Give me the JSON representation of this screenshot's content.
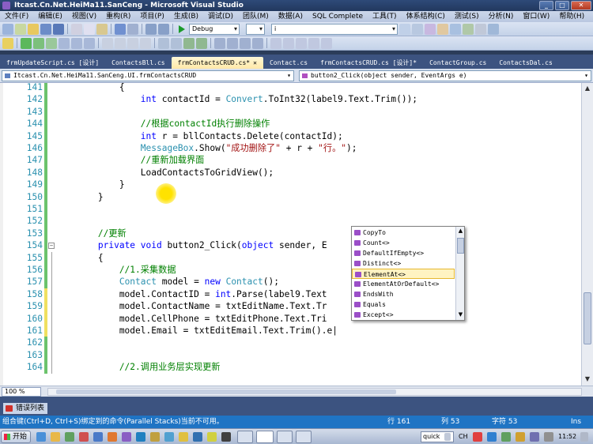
{
  "window": {
    "title": "Itcast.Cn.Net.HeiMa11.SanCeng - Microsoft Visual Studio",
    "controls": [
      "_",
      "□",
      "✕"
    ]
  },
  "menu": [
    "文件(F)",
    "编辑(E)",
    "视图(V)",
    "重构(R)",
    "项目(P)",
    "生成(B)",
    "调试(D)",
    "团队(M)",
    "数据(A)",
    "SQL Complete",
    "工具(T)",
    "体系结构(C)",
    "测试(S)",
    "分析(N)",
    "窗口(W)",
    "帮助(H)"
  ],
  "toolbar": {
    "config": "Debug",
    "search": "i"
  },
  "tabs": [
    {
      "label": "frmUpdateScript.cs [设计]",
      "active": false
    },
    {
      "label": "ContactsBll.cs",
      "active": false
    },
    {
      "label": "frmContactsCRUD.cs*",
      "active": true
    },
    {
      "label": "Contact.cs",
      "active": false
    },
    {
      "label": "frmContactsCRUD.cs [设计]*",
      "active": false
    },
    {
      "label": "ContactGroup.cs",
      "active": false
    },
    {
      "label": "ContactsDal.cs",
      "active": false
    }
  ],
  "nav": {
    "class_combo": "Itcast.Cn.Net.HeiMa11.SanCeng.UI.frmContactsCRUD",
    "member_combo": "button2_Click(object sender, EventArgs e)"
  },
  "code_lines": [
    {
      "n": "141",
      "mark": "green",
      "tokens": [
        {
          "c": "tx",
          "t": "            {"
        }
      ]
    },
    {
      "n": "142",
      "mark": "green",
      "tokens": [
        {
          "c": "tx",
          "t": "                "
        },
        {
          "c": "kw",
          "t": "int"
        },
        {
          "c": "tx",
          "t": " contactId = "
        },
        {
          "c": "ty",
          "t": "Convert"
        },
        {
          "c": "tx",
          "t": ".ToInt32(label9.Text.Trim());"
        }
      ]
    },
    {
      "n": "143",
      "mark": "green",
      "tokens": []
    },
    {
      "n": "144",
      "mark": "green",
      "tokens": [
        {
          "c": "cm",
          "t": "                //根据contactId执行删除操作"
        }
      ]
    },
    {
      "n": "145",
      "mark": "green",
      "tokens": [
        {
          "c": "tx",
          "t": "                "
        },
        {
          "c": "kw",
          "t": "int"
        },
        {
          "c": "tx",
          "t": " r = bllContacts.Delete(contactId);"
        }
      ]
    },
    {
      "n": "146",
      "mark": "green",
      "tokens": [
        {
          "c": "tx",
          "t": "                "
        },
        {
          "c": "ty",
          "t": "MessageBox"
        },
        {
          "c": "tx",
          "t": ".Show("
        },
        {
          "c": "st",
          "t": "\"成功删除了\""
        },
        {
          "c": "tx",
          "t": " + r + "
        },
        {
          "c": "st",
          "t": "\"行。\""
        },
        {
          "c": "tx",
          "t": ");"
        }
      ]
    },
    {
      "n": "147",
      "mark": "green",
      "tokens": [
        {
          "c": "cm",
          "t": "                //重新加载界面"
        }
      ]
    },
    {
      "n": "148",
      "mark": "green",
      "tokens": [
        {
          "c": "tx",
          "t": "                LoadContactsToGridView();"
        }
      ]
    },
    {
      "n": "149",
      "mark": "green",
      "tokens": [
        {
          "c": "tx",
          "t": "            }"
        }
      ]
    },
    {
      "n": "150",
      "mark": "green",
      "tokens": [
        {
          "c": "tx",
          "t": "        }"
        }
      ]
    },
    {
      "n": "151",
      "mark": "green",
      "tokens": []
    },
    {
      "n": "152",
      "mark": "green",
      "tokens": []
    },
    {
      "n": "153",
      "mark": "green",
      "tokens": [
        {
          "c": "cm",
          "t": "        //更新"
        }
      ]
    },
    {
      "n": "154",
      "mark": "green",
      "fold": true,
      "tokens": [
        {
          "c": "tx",
          "t": "        "
        },
        {
          "c": "kw",
          "t": "private"
        },
        {
          "c": "tx",
          "t": " "
        },
        {
          "c": "kw",
          "t": "void"
        },
        {
          "c": "tx",
          "t": " button2_Click("
        },
        {
          "c": "kw",
          "t": "object"
        },
        {
          "c": "tx",
          "t": " sender, E"
        }
      ]
    },
    {
      "n": "155",
      "mark": "green",
      "tokens": [
        {
          "c": "tx",
          "t": "        {"
        }
      ]
    },
    {
      "n": "156",
      "mark": "green",
      "tokens": [
        {
          "c": "cm",
          "t": "            //1.采集数据"
        }
      ]
    },
    {
      "n": "157",
      "mark": "green",
      "tokens": [
        {
          "c": "tx",
          "t": "            "
        },
        {
          "c": "ty",
          "t": "Contact"
        },
        {
          "c": "tx",
          "t": " model = "
        },
        {
          "c": "kw",
          "t": "new"
        },
        {
          "c": "tx",
          "t": " "
        },
        {
          "c": "ty",
          "t": "Contact"
        },
        {
          "c": "tx",
          "t": "();"
        }
      ]
    },
    {
      "n": "158",
      "mark": "yellow",
      "tokens": [
        {
          "c": "tx",
          "t": "            model.ContactID = "
        },
        {
          "c": "kw",
          "t": "int"
        },
        {
          "c": "tx",
          "t": ".Parse(label9.Text"
        }
      ]
    },
    {
      "n": "159",
      "mark": "yellow",
      "tokens": [
        {
          "c": "tx",
          "t": "            model.ContactName = txtEditName.Text.Tr"
        }
      ]
    },
    {
      "n": "160",
      "mark": "yellow",
      "tokens": [
        {
          "c": "tx",
          "t": "            model.CellPhone = txtEditPhone.Text.Tri"
        }
      ]
    },
    {
      "n": "161",
      "mark": "yellow",
      "tokens": [
        {
          "c": "tx",
          "t": "            model.Email = txtEditEmail.Text.Trim().e|"
        }
      ]
    },
    {
      "n": "162",
      "mark": "green",
      "tokens": []
    },
    {
      "n": "163",
      "mark": "green",
      "tokens": []
    },
    {
      "n": "164",
      "mark": "green",
      "tokens": [
        {
          "c": "cm",
          "t": "            //2.调用业务层实现更新"
        }
      ]
    }
  ],
  "intellisense": {
    "items": [
      "CopyTo",
      "Count<>",
      "DefaultIfEmpty<>",
      "Distinct<>",
      "ElementAt<>",
      "ElementAtOrDefault<>",
      "EndsWith",
      "Equals",
      "Except<>"
    ],
    "selected_index": 4
  },
  "zoom": "100 %",
  "error_panel_tab": "错误列表",
  "status": {
    "message": "组合键(Ctrl+D, Ctrl+S)绑定到的命令(Parallel Stacks)当前不可用。",
    "line": "行 161",
    "col": "列 53",
    "char": "字符 53",
    "mode": "Ins"
  },
  "taskbar": {
    "start": "开始",
    "quick": "quick",
    "lang": "CH",
    "clock": "11:52"
  }
}
